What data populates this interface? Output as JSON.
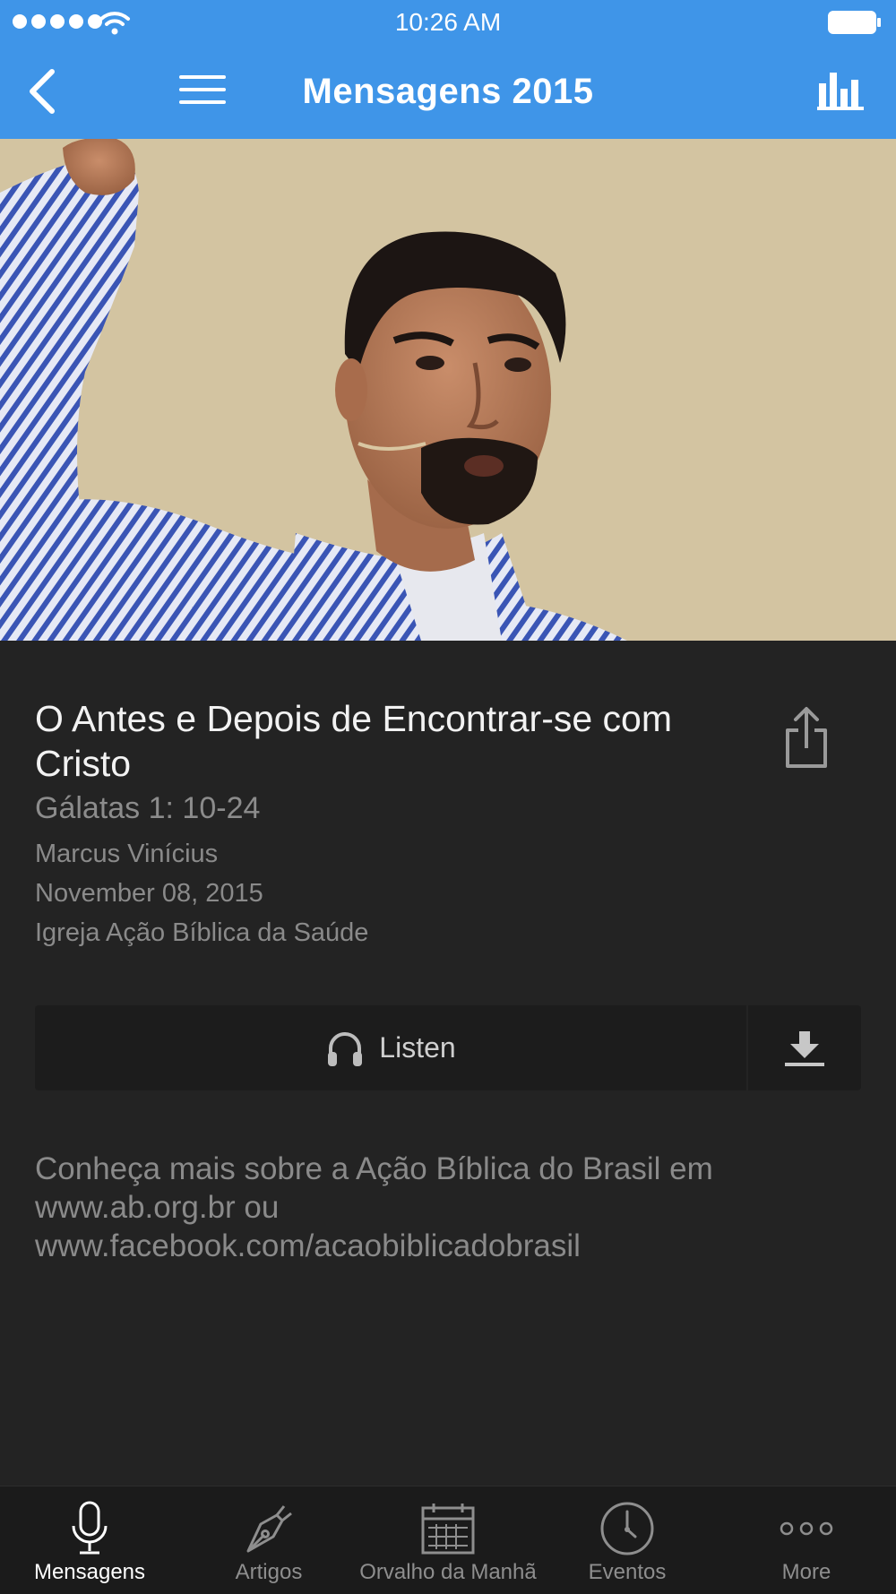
{
  "status_bar": {
    "time": "10:26 AM"
  },
  "nav": {
    "title": "Mensagens 2015"
  },
  "message": {
    "title": "O Antes e Depois de Encontrar-se com Cristo",
    "scripture": "Gálatas 1: 10-24",
    "speaker": "Marcus Vinícius",
    "date": "November 08, 2015",
    "church": "Igreja Ação Bíblica da Saúde"
  },
  "actions": {
    "listen_label": "Listen"
  },
  "description": {
    "line1": "Conheça mais sobre a Ação Bíblica do Brasil em",
    "line2": "www.ab.org.br ou",
    "line3": "www.facebook.com/acaobiblicadobrasil"
  },
  "tabs": [
    {
      "label": "Mensagens",
      "icon": "microphone-icon",
      "active": true
    },
    {
      "label": "Artigos",
      "icon": "pen-nib-icon",
      "active": false
    },
    {
      "label": "Orvalho da Manhã",
      "icon": "calendar-icon",
      "active": false
    },
    {
      "label": "Eventos",
      "icon": "clock-icon",
      "active": false
    },
    {
      "label": "More",
      "icon": "more-icon",
      "active": false
    }
  ],
  "colors": {
    "accent": "#3f95e8",
    "background": "#232323",
    "tabbar": "#1b1b1b"
  }
}
